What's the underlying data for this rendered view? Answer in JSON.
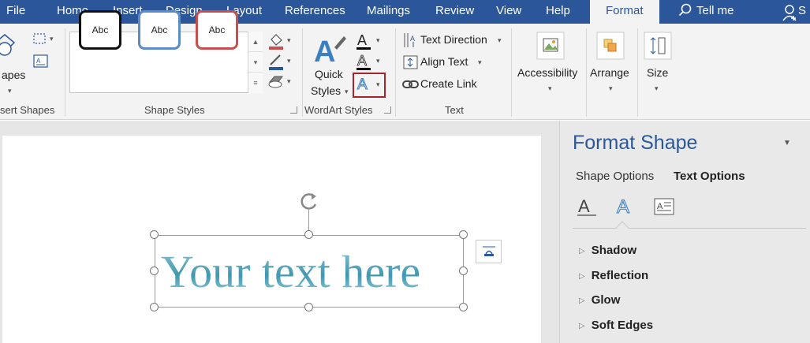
{
  "tabs": [
    "File",
    "Home",
    "Insert",
    "Design",
    "Layout",
    "References",
    "Mailings",
    "Review",
    "View",
    "Help",
    "Format"
  ],
  "tell_me": "Tell me",
  "share_initial": "S",
  "ribbon": {
    "insert_shapes": {
      "label": "sert Shapes",
      "shapes_label": "apes"
    },
    "shape_styles": {
      "label": "Shape Styles",
      "swatch_text": "Abc",
      "swatch_colors": [
        "#111111",
        "#5b8cc8",
        "#c94f4f"
      ]
    },
    "wordart_styles": {
      "label": "WordArt Styles",
      "quick_styles_line1": "Quick",
      "quick_styles_line2": "Styles"
    },
    "text": {
      "label": "Text",
      "text_direction": "Text Direction",
      "align_text": "Align Text",
      "create_link": "Create Link"
    },
    "arrange": {
      "accessibility": "Accessibility",
      "arrange": "Arrange",
      "size": "Size"
    }
  },
  "document": {
    "wordart_text": "Your text here"
  },
  "pane": {
    "title": "Format Shape",
    "tab_shape": "Shape Options",
    "tab_text": "Text Options",
    "sections": [
      "Shadow",
      "Reflection",
      "Glow",
      "Soft Edges"
    ]
  },
  "colors": {
    "accent": "#2b579a",
    "selection_highlight": "#a4262c"
  }
}
